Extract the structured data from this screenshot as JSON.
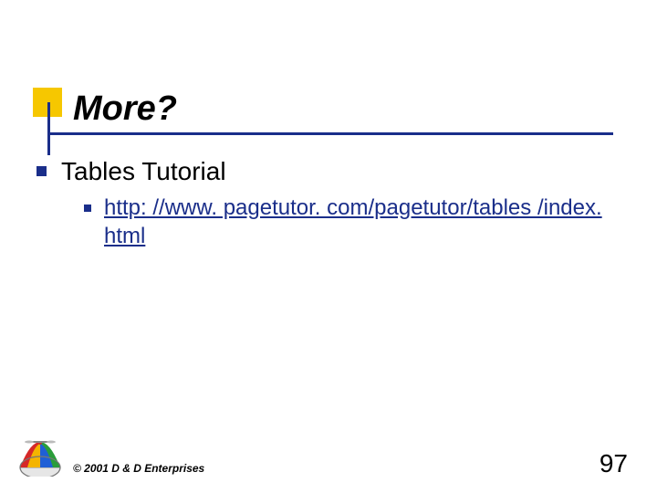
{
  "title": "More?",
  "body": {
    "level1_text": "Tables Tutorial",
    "level2_link": "http: //www. pagetutor. com/pagetutor/tables /index. html"
  },
  "footer": {
    "copyright": "© 2001 D & D Enterprises",
    "page_number": "97"
  },
  "colors": {
    "accent_yellow": "#f6c700",
    "accent_navy": "#1a2e8a"
  },
  "icons": {
    "logo": "propeller-beanie"
  }
}
